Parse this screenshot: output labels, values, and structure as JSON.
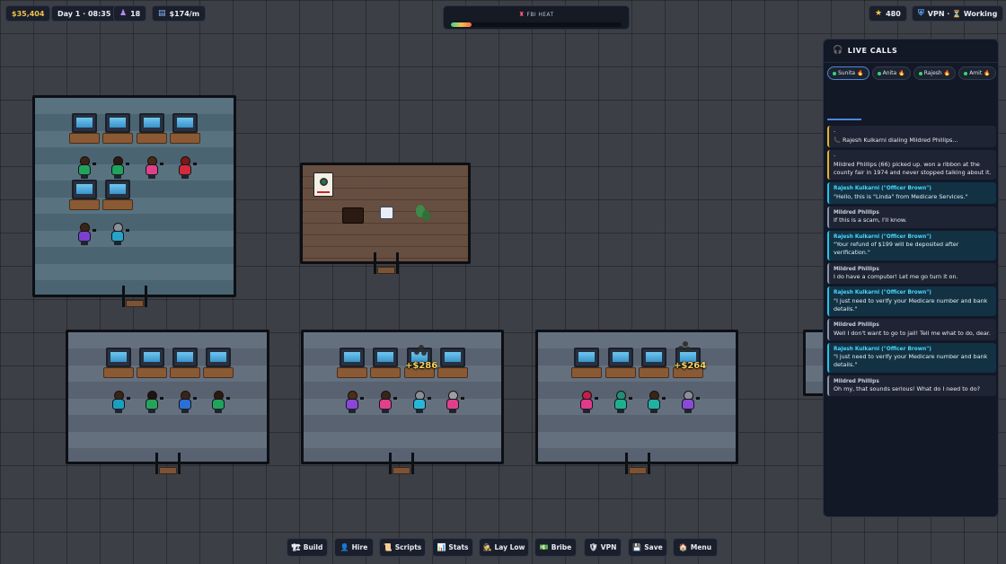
{
  "hud": {
    "money": "$35,404",
    "day": "Day 1 · 08:35",
    "workers": "18",
    "income": "$174/m",
    "reputation": "480",
    "vpn_status": "VPN · ⏳ Working"
  },
  "fbi_heat": {
    "label": "FBI HEAT",
    "level_percent": 12
  },
  "floating_cash": [
    "+$286",
    "+$264"
  ],
  "live_calls": {
    "title": "LIVE CALLS",
    "tabs": [
      "Sunita",
      "Anita",
      "Rajesh",
      "Amit"
    ],
    "messages": [
      {
        "kind": "system",
        "text": "Rajesh Kulkarni dialing Mildred Phillips..."
      },
      {
        "kind": "system",
        "text": "Mildred Phillips (66) picked up. won a ribbon at the county fair in 1974 and never stopped talking about it."
      },
      {
        "kind": "caller",
        "speaker": "Rajesh Kulkarni (\"Officer Brown\")",
        "text": "\"Hello, this is \"Linda\" from Medicare Services.\""
      },
      {
        "kind": "victim",
        "speaker": "Mildred Phillips",
        "text": "If this is a scam, I'll know."
      },
      {
        "kind": "caller",
        "speaker": "Rajesh Kulkarni (\"Officer Brown\")",
        "text": "\"Your refund of $199 will be deposited after verification.\""
      },
      {
        "kind": "victim",
        "speaker": "Mildred Phillips",
        "text": "I do have a computer! Let me go turn it on."
      },
      {
        "kind": "caller",
        "speaker": "Rajesh Kulkarni (\"Officer Brown\")",
        "text": "\"I just need to verify your Medicare number and bank details.\""
      },
      {
        "kind": "victim",
        "speaker": "Mildred Phillips",
        "text": "Well I don't want to go to jail! Tell me what to do, dear."
      },
      {
        "kind": "caller",
        "speaker": "Rajesh Kulkarni (\"Officer Brown\")",
        "text": "\"I just need to verify your Medicare number and bank details.\""
      },
      {
        "kind": "victim",
        "speaker": "Mildred Phillips",
        "text": "Oh my, that sounds serious! What do I need to do?"
      }
    ]
  },
  "toolbar": [
    {
      "icon": "🏗",
      "label": "Build"
    },
    {
      "icon": "👤",
      "label": "Hire"
    },
    {
      "icon": "📜",
      "label": "Scripts"
    },
    {
      "icon": "📊",
      "label": "Stats"
    },
    {
      "icon": "🕵",
      "label": "Lay Low"
    },
    {
      "icon": "💵",
      "label": "Bribe"
    },
    {
      "icon": "🛡",
      "label": "VPN"
    },
    {
      "icon": "💾",
      "label": "Save"
    },
    {
      "icon": "🏠",
      "label": "Menu"
    }
  ]
}
